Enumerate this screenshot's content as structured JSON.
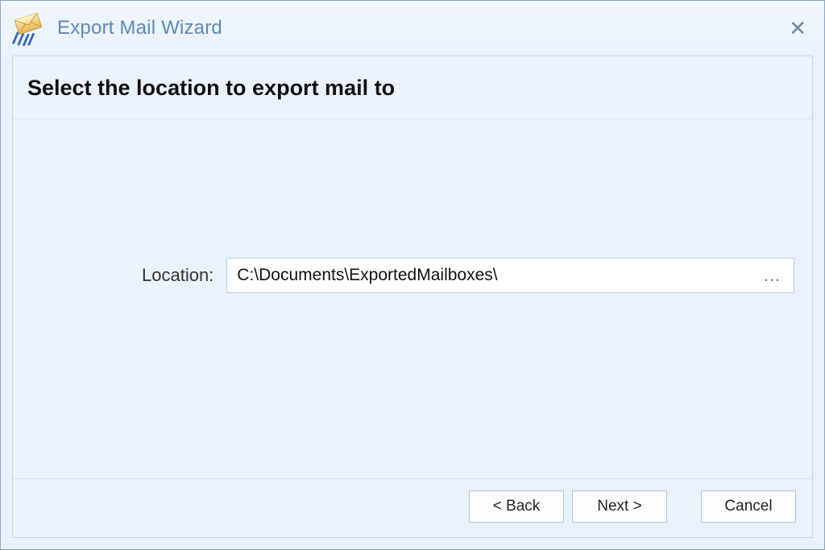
{
  "window": {
    "title": "Export Mail Wizard"
  },
  "main": {
    "heading": "Select the location to export mail to",
    "location_label": "Location:",
    "location_value": "C:\\Documents\\ExportedMailboxes\\"
  },
  "footer": {
    "back_label": "< Back",
    "next_label": "Next >",
    "cancel_label": "Cancel"
  },
  "icons": {
    "app": "mail-icon",
    "close": "close-icon",
    "browse": "ellipsis-icon"
  }
}
